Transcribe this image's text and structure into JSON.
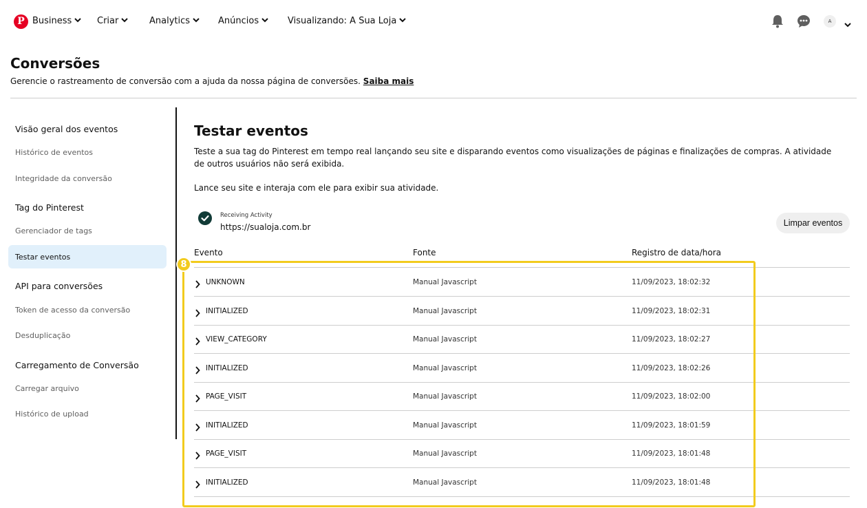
{
  "topnav": {
    "logo_letter": "P",
    "items": [
      {
        "label": "Business"
      },
      {
        "label": "Criar"
      },
      {
        "label": "Analytics"
      },
      {
        "label": "Anúncios"
      },
      {
        "label": "Visualizando: A Sua Loja"
      }
    ],
    "avatar_initial": "A"
  },
  "header": {
    "title": "Conversões",
    "description": "Gerencie o rastreamento de conversão com a ajuda da nossa página de conversões.",
    "link": "Saiba mais"
  },
  "sidebar": {
    "sections": [
      {
        "title": "Visão geral dos eventos",
        "items": [
          "Histórico de eventos",
          "Integridade da conversão"
        ]
      },
      {
        "title": "Tag do Pinterest",
        "items": [
          "Gerenciador de tags",
          "Testar eventos"
        ]
      },
      {
        "title": "API para conversões",
        "items": [
          "Token de acesso da conversão",
          "Desduplicação"
        ]
      },
      {
        "title": "Carregamento de Conversão",
        "items": [
          "Carregar arquivo",
          "Histórico de upload"
        ]
      }
    ],
    "active_item": "Testar eventos"
  },
  "main": {
    "title": "Testar eventos",
    "description": "Teste a sua tag do Pinterest em tempo real lançando seu site e disparando eventos como visualizações de páginas e finalizações de compras. A atividade de outros usuários não será exibida.",
    "hint": "Lance seu site e interaja com ele para exibir sua atividade.",
    "status_label": "Receiving Activity",
    "status_url": "https://sualoja.com.br",
    "clear_button": "Limpar eventos",
    "columns": [
      "Evento",
      "Fonte",
      "Registro de data/hora"
    ],
    "rows": [
      {
        "event": "UNKNOWN",
        "source": "Manual Javascript",
        "timestamp": "11/09/2023, 18:02:32"
      },
      {
        "event": "INITIALIZED",
        "source": "Manual Javascript",
        "timestamp": "11/09/2023, 18:02:31"
      },
      {
        "event": "VIEW_CATEGORY",
        "source": "Manual Javascript",
        "timestamp": "11/09/2023, 18:02:27"
      },
      {
        "event": "INITIALIZED",
        "source": "Manual Javascript",
        "timestamp": "11/09/2023, 18:02:26"
      },
      {
        "event": "PAGE_VISIT",
        "source": "Manual Javascript",
        "timestamp": "11/09/2023, 18:02:00"
      },
      {
        "event": "INITIALIZED",
        "source": "Manual Javascript",
        "timestamp": "11/09/2023, 18:01:59"
      },
      {
        "event": "PAGE_VISIT",
        "source": "Manual Javascript",
        "timestamp": "11/09/2023, 18:01:48"
      },
      {
        "event": "INITIALIZED",
        "source": "Manual Javascript",
        "timestamp": "11/09/2023, 18:01:48"
      }
    ]
  },
  "annotation": {
    "badge_number": "8",
    "color": "#f2cb1d"
  },
  "colors": {
    "brand": "#e60023",
    "active_bg": "#e1f0fb",
    "status_icon": "#113b37"
  }
}
